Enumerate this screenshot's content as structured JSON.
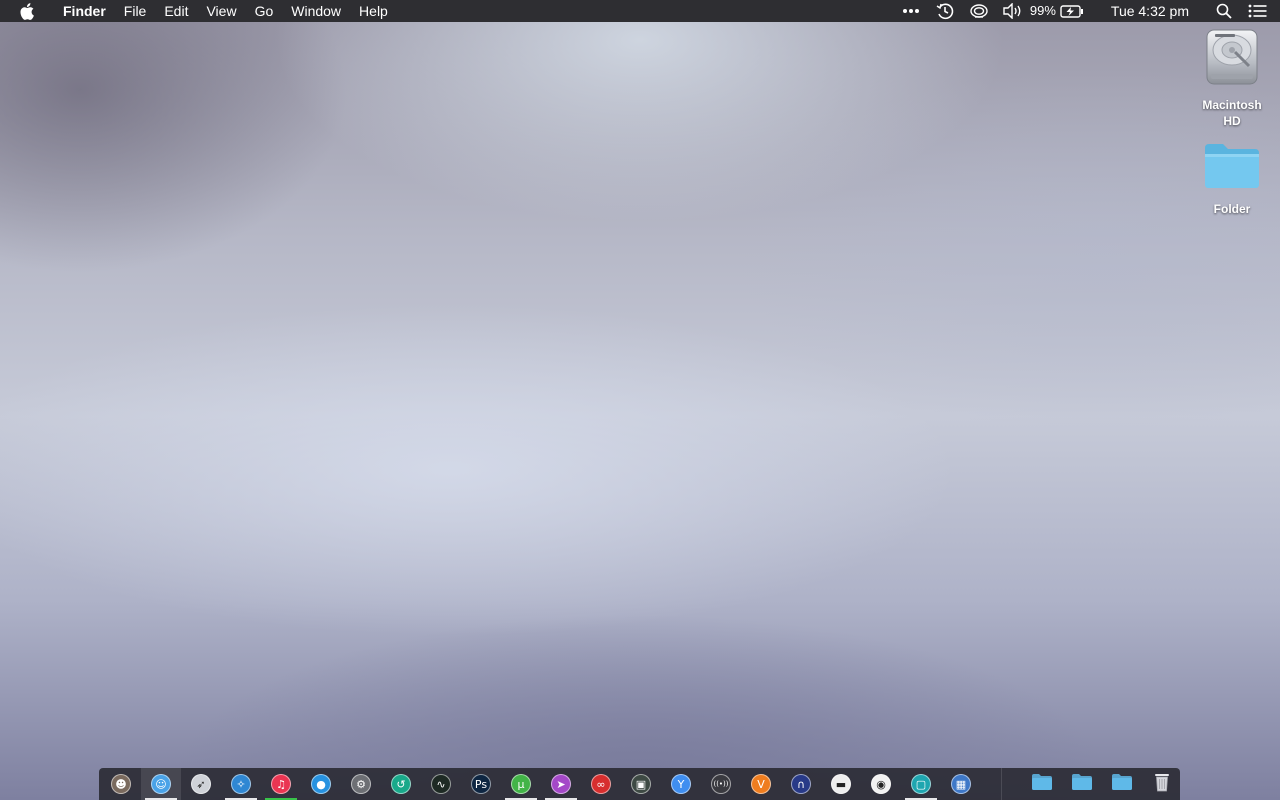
{
  "menubar": {
    "apple_icon": "apple-logo-icon",
    "app_name": "Finder",
    "menus": [
      "File",
      "Edit",
      "View",
      "Go",
      "Window",
      "Help"
    ],
    "status": {
      "more_icon": "ellipsis-icon",
      "time_machine_icon": "time-machine-icon",
      "airplay_icon": "screen-mirroring-icon",
      "volume_icon": "volume-icon",
      "battery_percent": "99%",
      "battery_icon": "battery-charging-icon",
      "clock": "Tue 4:32 pm",
      "spotlight_icon": "search-icon",
      "notification_icon": "notification-center-icon"
    }
  },
  "desktop": {
    "icons": [
      {
        "label": "Macintosh HD",
        "icon": "hard-drive-icon"
      },
      {
        "label": "Folder",
        "icon": "folder-icon",
        "color": "#6fc6ec"
      }
    ]
  },
  "dock": {
    "apps": [
      {
        "name": "app-mask",
        "icon": "mask-icon",
        "bg": "#7a6a5e",
        "glyph": "☻",
        "running": false
      },
      {
        "name": "finder",
        "icon": "finder-icon",
        "bg": "#4aa3e8",
        "glyph": "☺",
        "running": true,
        "active": true
      },
      {
        "name": "launchpad",
        "icon": "rocket-icon",
        "bg": "#cfd2d8",
        "glyph": "➶",
        "running": false
      },
      {
        "name": "safari",
        "icon": "compass-icon",
        "bg": "#2f87d3",
        "glyph": "✧",
        "running": true
      },
      {
        "name": "music",
        "icon": "music-note-icon",
        "bg": "#ea3552",
        "glyph": "♫",
        "running": true,
        "green": true
      },
      {
        "name": "app-store",
        "icon": "apple-circle-icon",
        "bg": "#2792e0",
        "glyph": "●",
        "running": false
      },
      {
        "name": "system-preferences",
        "icon": "settings-icon",
        "bg": "#6d6f74",
        "glyph": "⚙",
        "running": false
      },
      {
        "name": "time-machine",
        "icon": "clock-arrow-icon",
        "bg": "#19a98a",
        "glyph": "↺",
        "running": false
      },
      {
        "name": "activity-monitor",
        "icon": "activity-icon",
        "bg": "#1e2a24",
        "glyph": "∿",
        "running": false
      },
      {
        "name": "photoshop",
        "icon": "ps-icon",
        "bg": "#0e2642",
        "glyph": "Ps",
        "running": false
      },
      {
        "name": "utorrent",
        "icon": "torrent-icon",
        "bg": "#42b447",
        "glyph": "µ",
        "running": true
      },
      {
        "name": "app-purple",
        "icon": "purple-arrow-icon",
        "bg": "#a448c8",
        "glyph": "➤",
        "running": true
      },
      {
        "name": "app-red",
        "icon": "red-badge-icon",
        "bg": "#d72e2e",
        "glyph": "∞",
        "running": false
      },
      {
        "name": "app-photo",
        "icon": "photo-frame-icon",
        "bg": "#3e4a44",
        "glyph": "▣",
        "running": false
      },
      {
        "name": "app-blue-y",
        "icon": "y-shape-icon",
        "bg": "#3f8ef0",
        "glyph": "Y",
        "running": false
      },
      {
        "name": "app-signal",
        "icon": "broadcast-icon",
        "bg": "#3a3a40",
        "glyph": "((•))",
        "running": false
      },
      {
        "name": "vlc",
        "icon": "vlc-icon",
        "bg": "#ef7d1f",
        "glyph": "V",
        "running": false
      },
      {
        "name": "app-headphones",
        "icon": "headphones-icon",
        "bg": "#283a88",
        "glyph": "∩",
        "running": false
      },
      {
        "name": "app-card",
        "icon": "card-reader-icon",
        "bg": "#eeeeee",
        "glyph": "▬",
        "running": false
      },
      {
        "name": "app-camera",
        "icon": "camera-icon",
        "bg": "#f2f2f2",
        "glyph": "◉",
        "running": false
      },
      {
        "name": "app-screen",
        "icon": "screenshot-icon",
        "bg": "#1fa6b0",
        "glyph": "▢",
        "running": true
      },
      {
        "name": "app-windows",
        "icon": "windows-icon",
        "bg": "#3e78c8",
        "glyph": "▦",
        "running": false
      }
    ],
    "folders": [
      {
        "name": "applications-folder",
        "icon": "applications-folder-icon",
        "color": "#5fb9e8"
      },
      {
        "name": "downloads-folder",
        "icon": "downloads-folder-icon",
        "color": "#5fb9e8"
      },
      {
        "name": "documents-folder",
        "icon": "documents-folder-icon",
        "color": "#5fb9e8"
      }
    ],
    "trash_icon": "trash-icon"
  }
}
